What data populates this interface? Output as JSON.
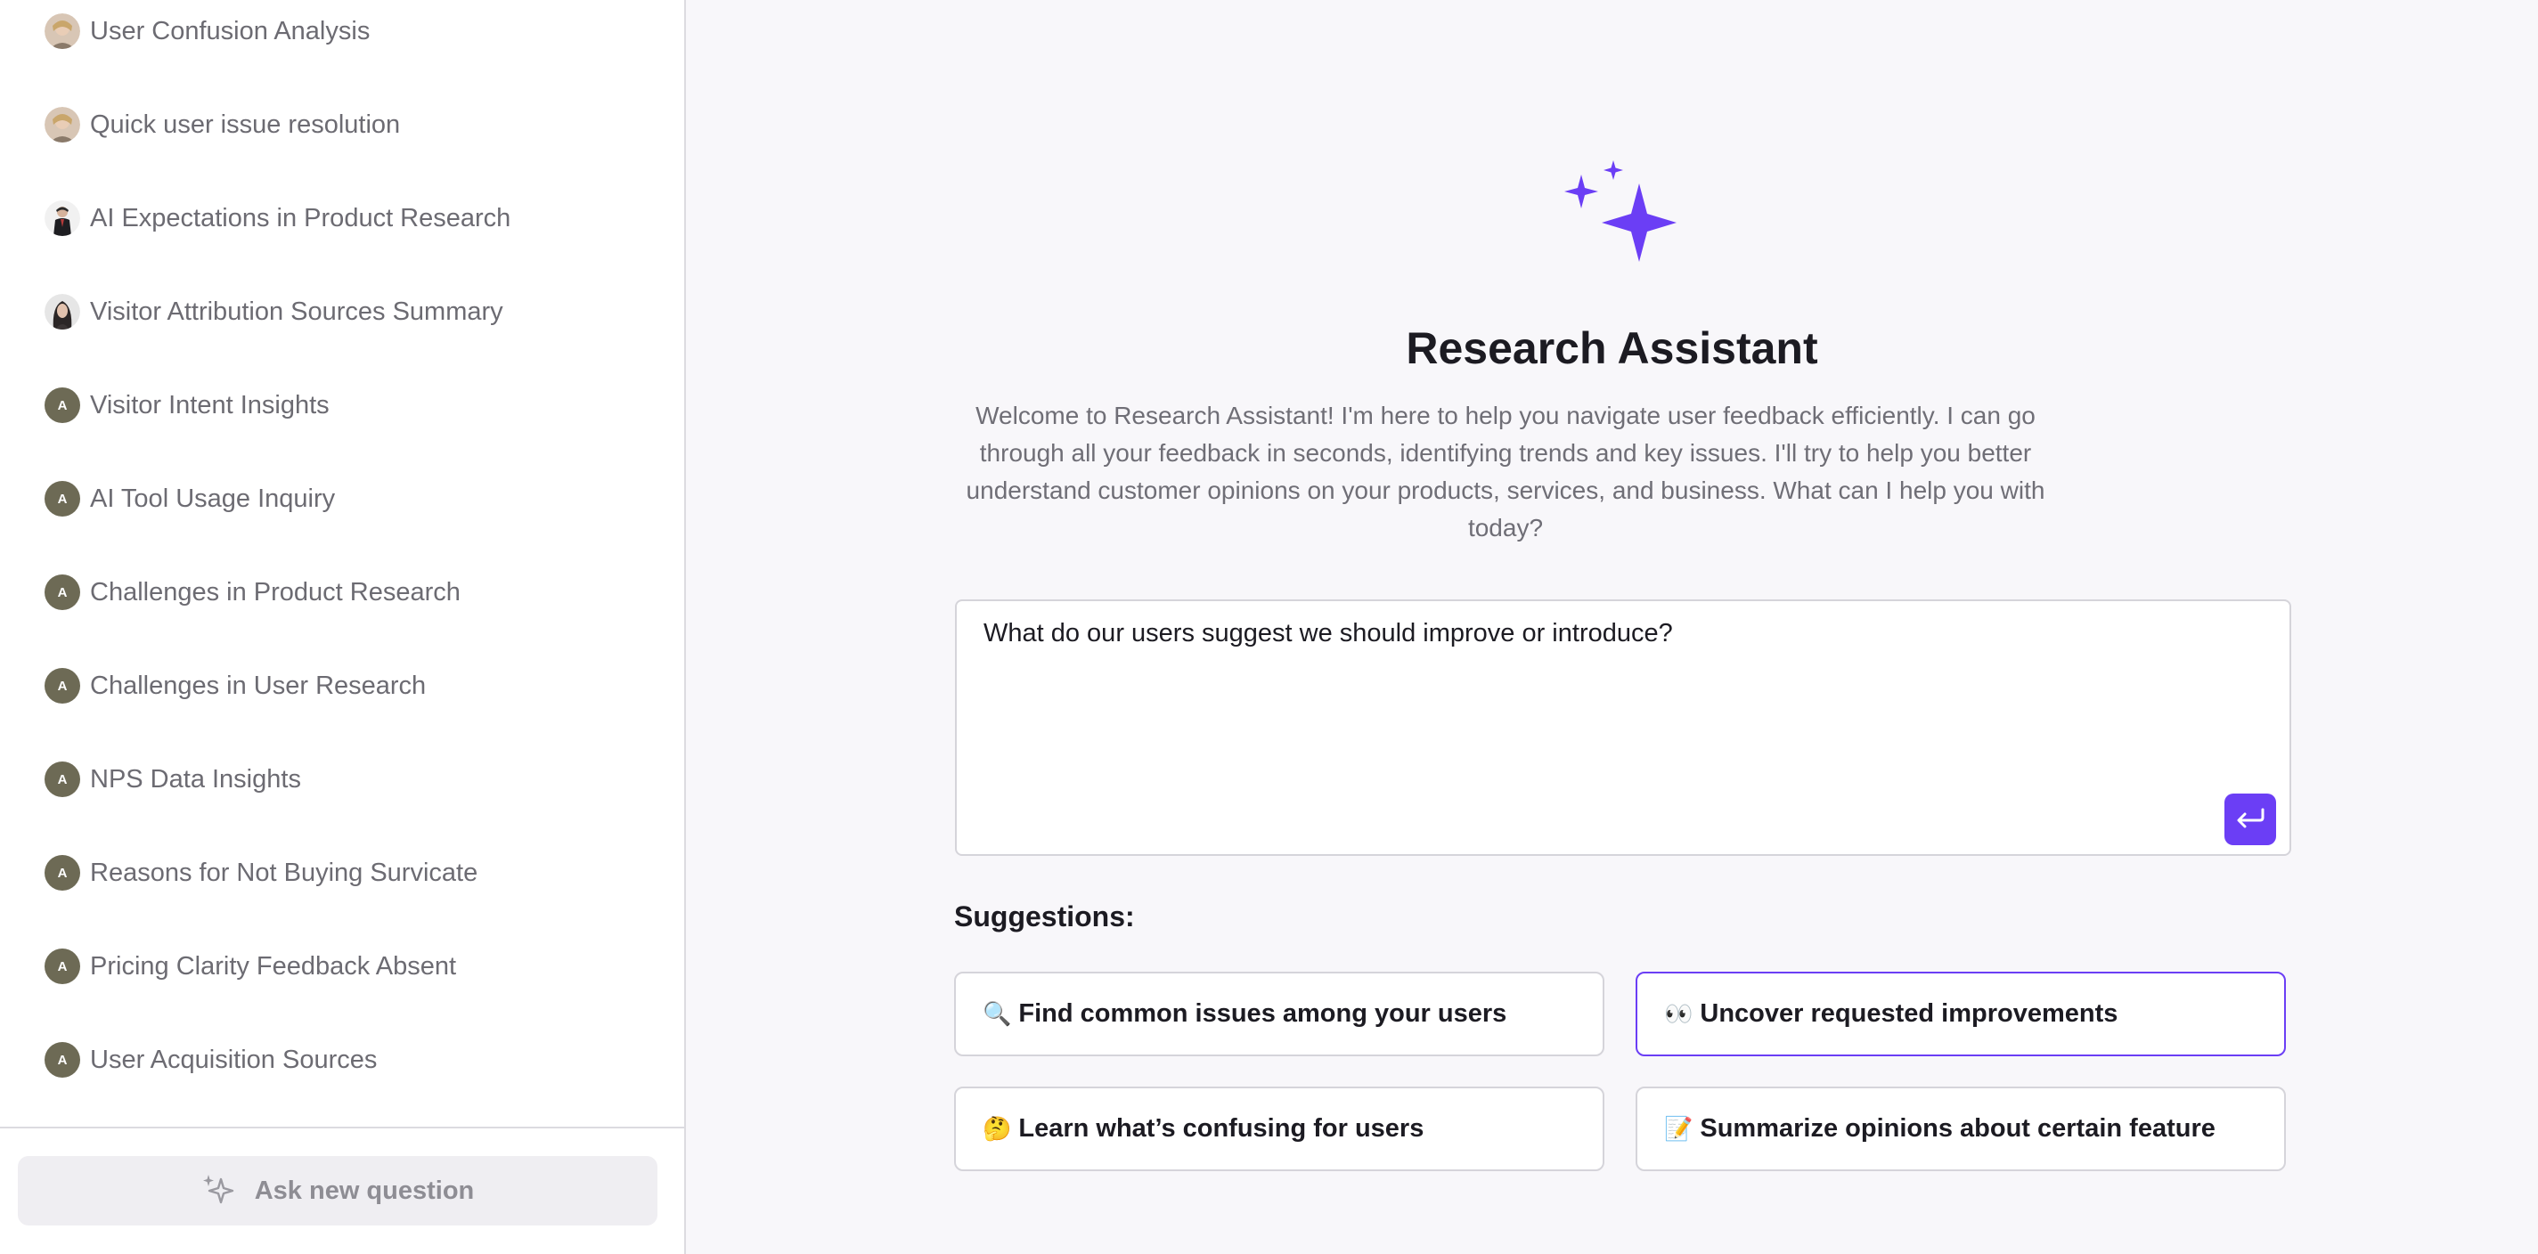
{
  "sidebar": {
    "items": [
      {
        "label": "User Confusion Analysis",
        "avatar": "photo-woman-blonde"
      },
      {
        "label": "Quick user issue resolution",
        "avatar": "photo-woman-blonde"
      },
      {
        "label": "AI Expectations in Product Research",
        "avatar": "photo-man-suit"
      },
      {
        "label": "Visitor Attribution Sources Summary",
        "avatar": "photo-woman-dark"
      },
      {
        "label": "Visitor Intent Insights",
        "avatar": "A"
      },
      {
        "label": "AI Tool Usage Inquiry",
        "avatar": "A"
      },
      {
        "label": "Challenges in Product Research",
        "avatar": "A"
      },
      {
        "label": "Challenges in User Research",
        "avatar": "A"
      },
      {
        "label": "NPS Data Insights",
        "avatar": "A"
      },
      {
        "label": "Reasons for Not Buying Survicate",
        "avatar": "A"
      },
      {
        "label": "Pricing Clarity Feedback Absent",
        "avatar": "A"
      },
      {
        "label": "User Acquisition Sources",
        "avatar": "A"
      }
    ],
    "ask_new_label": "Ask new question",
    "ask_new_icon": "sparkles-icon"
  },
  "main": {
    "hero_icon": "sparkles-icon",
    "title": "Research Assistant",
    "welcome": "Welcome to Research Assistant! I'm here to help you navigate user feedback efficiently. I can go through all your feedback in seconds, identifying trends and key issues. I'll try to help you better understand customer opinions on your products, services, and business. What can I help you with today?",
    "input_value": "What do our users suggest we should improve or introduce?",
    "send_icon": "enter-arrow-icon",
    "suggestions_title": "Suggestions:",
    "suggestions": [
      {
        "emoji": "🔍",
        "label": "Find common issues among your users"
      },
      {
        "emoji": "👀",
        "label": "Uncover requested improvements"
      },
      {
        "emoji": "🤔",
        "label": "Learn what’s confusing for users"
      },
      {
        "emoji": "📝",
        "label": "Summarize opinions about certain feature"
      }
    ]
  },
  "colors": {
    "accent": "#6b3ef5",
    "background": "#f8f7fa",
    "sidebar_background": "#ffffff",
    "avatar_letter_bg": "#6d6a55"
  }
}
